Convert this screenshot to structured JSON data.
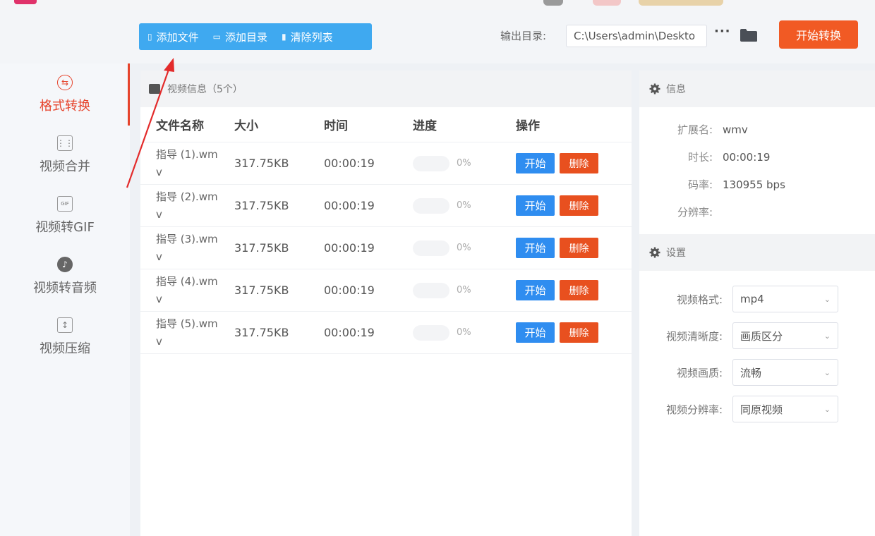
{
  "toolbar": {
    "add_file": "添加文件",
    "add_dir": "添加目录",
    "clear_list": "清除列表",
    "output_label": "输出目录:",
    "output_path": "C:\\Users\\admin\\Deskto",
    "more": "···",
    "start_convert": "开始转换"
  },
  "sidebar": {
    "items": [
      {
        "label": "格式转换",
        "icon": "convert-icon",
        "active": true
      },
      {
        "label": "视频合并",
        "icon": "merge-icon",
        "active": false
      },
      {
        "label": "视频转GIF",
        "icon": "gif-icon",
        "active": false
      },
      {
        "label": "视频转音频",
        "icon": "audio-icon",
        "active": false
      },
      {
        "label": "视频压缩",
        "icon": "compress-icon",
        "active": false
      }
    ]
  },
  "file_panel": {
    "title": "视频信息（5个）",
    "columns": [
      "文件名称",
      "大小",
      "时间",
      "进度",
      "操作"
    ],
    "rows": [
      {
        "name": "指导 (1).wmv",
        "size": "317.75KB",
        "time": "00:00:19",
        "progress": "0%"
      },
      {
        "name": "指导 (2).wmv",
        "size": "317.75KB",
        "time": "00:00:19",
        "progress": "0%"
      },
      {
        "name": "指导 (3).wmv",
        "size": "317.75KB",
        "time": "00:00:19",
        "progress": "0%"
      },
      {
        "name": "指导 (4).wmv",
        "size": "317.75KB",
        "time": "00:00:19",
        "progress": "0%"
      },
      {
        "name": "指导 (5).wmv",
        "size": "317.75KB",
        "time": "00:00:19",
        "progress": "0%"
      }
    ],
    "start_label": "开始",
    "delete_label": "删除"
  },
  "info": {
    "title": "信息",
    "ext_label": "扩展名:",
    "ext_value": "wmv",
    "duration_label": "时长:",
    "duration_value": "00:00:19",
    "bitrate_label": "码率:",
    "bitrate_value": "130955 bps",
    "resolution_label": "分辨率:",
    "resolution_value": ""
  },
  "settings": {
    "title": "设置",
    "format_label": "视频格式:",
    "format_value": "mp4",
    "clarity_label": "视频清晰度:",
    "clarity_value": "画质区分",
    "quality_label": "视频画质:",
    "quality_value": "流畅",
    "resolution_label": "视频分辨率:",
    "resolution_value": "同原视频"
  },
  "colors": {
    "accent_red": "#e6442c",
    "start_orange": "#f15a24",
    "toolbar_blue": "#3fa9f0",
    "button_blue": "#2f8df0"
  }
}
